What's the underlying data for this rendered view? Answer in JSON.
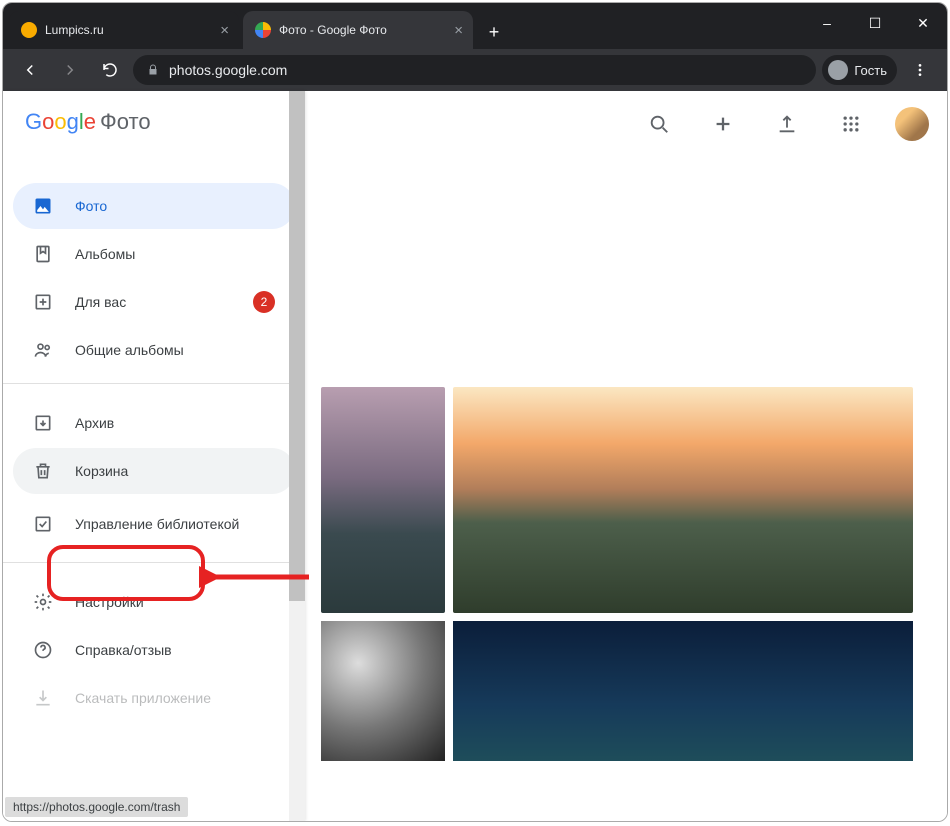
{
  "window": {
    "minimize": "–",
    "maximize": "☐",
    "close": "✕"
  },
  "tabs": [
    {
      "title": "Lumpics.ru",
      "fav_color": "#f9ab00"
    },
    {
      "title": "Фото - Google Фото",
      "fav_icon": "pinwheel"
    }
  ],
  "addr": {
    "url_host": "photos.google.com",
    "guest_label": "Гость"
  },
  "logo": {
    "letters": [
      {
        "t": "G",
        "c": "#4285F4"
      },
      {
        "t": "o",
        "c": "#EA4335"
      },
      {
        "t": "o",
        "c": "#FBBC05"
      },
      {
        "t": "g",
        "c": "#4285F4"
      },
      {
        "t": "l",
        "c": "#34A853"
      },
      {
        "t": "e",
        "c": "#EA4335"
      }
    ],
    "suffix": "Фото"
  },
  "sidebar": {
    "items": [
      {
        "label": "Фото",
        "icon": "image",
        "active": true
      },
      {
        "label": "Альбомы",
        "icon": "bookmark"
      },
      {
        "label": "Для вас",
        "icon": "plusbox",
        "badge": "2"
      },
      {
        "label": "Общие альбомы",
        "icon": "people"
      }
    ],
    "items2": [
      {
        "label": "Архив",
        "icon": "archive"
      },
      {
        "label": "Корзина",
        "icon": "trash",
        "hover": true
      },
      {
        "label": "Управление библиотекой",
        "icon": "check"
      }
    ],
    "items3": [
      {
        "label": "Настройки",
        "icon": "gear"
      },
      {
        "label": "Справка/отзыв",
        "icon": "help"
      },
      {
        "label": "Скачать приложение",
        "icon": "download"
      }
    ]
  },
  "status_url": "https://photos.google.com/trash"
}
